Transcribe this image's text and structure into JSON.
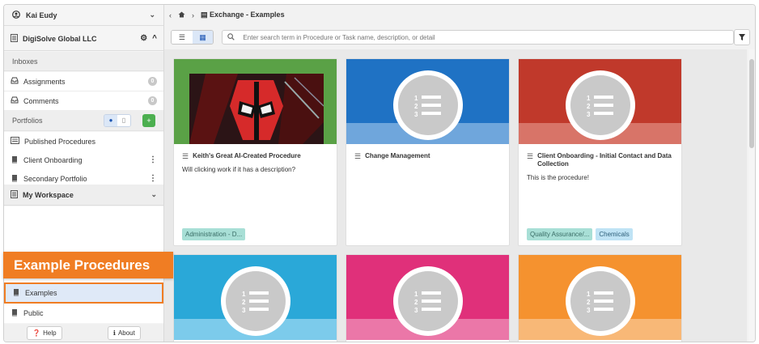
{
  "user": {
    "name": "Kai Eudy"
  },
  "org": {
    "name": "DigiSolve Global LLC"
  },
  "inboxes": {
    "label": "Inboxes",
    "items": [
      {
        "label": "Assignments",
        "count": "0"
      },
      {
        "label": "Comments",
        "count": "0"
      }
    ]
  },
  "portfolios": {
    "label": "Portfolios",
    "items": [
      {
        "label": "Published Procedures"
      },
      {
        "label": "Client Onboarding"
      },
      {
        "label": "Secondary Portfolio"
      }
    ]
  },
  "workspace": {
    "label": "My Workspace"
  },
  "bottom_items": [
    {
      "label": "Examples"
    },
    {
      "label": "Public"
    }
  ],
  "footer": {
    "help": "Help",
    "about": "About"
  },
  "callout": "Example Procedures",
  "breadcrumb": {
    "current": "Exchange - Examples"
  },
  "search": {
    "placeholder": "Enter search term in Procedure or Task name, description, or detail"
  },
  "cards": [
    {
      "title": "Keith's Great AI-Created Procedure",
      "description": "Will clicking work if it has a description?",
      "tags": [
        "Administration - D..."
      ],
      "color": "#5aa146"
    },
    {
      "title": "Change Management",
      "description": "",
      "tags": [],
      "color": "#1f72c4"
    },
    {
      "title": "Client Onboarding - Initial Contact and Data Collection",
      "description": "This is the procedure!",
      "tags": [
        "Quality Assurance/...",
        "Chemicals"
      ],
      "color": "#c0392b"
    },
    {
      "title": "",
      "description": "",
      "tags": [],
      "color": "#2aa8d8"
    },
    {
      "title": "",
      "description": "",
      "tags": [],
      "color": "#e0307a"
    },
    {
      "title": "",
      "description": "",
      "tags": [],
      "color": "#f5922f"
    }
  ],
  "colors": {
    "accent": "#f07d23",
    "tag_green": "#a8dfd6",
    "tag_blue": "#bfe3f5",
    "add_button": "#4caf50"
  }
}
